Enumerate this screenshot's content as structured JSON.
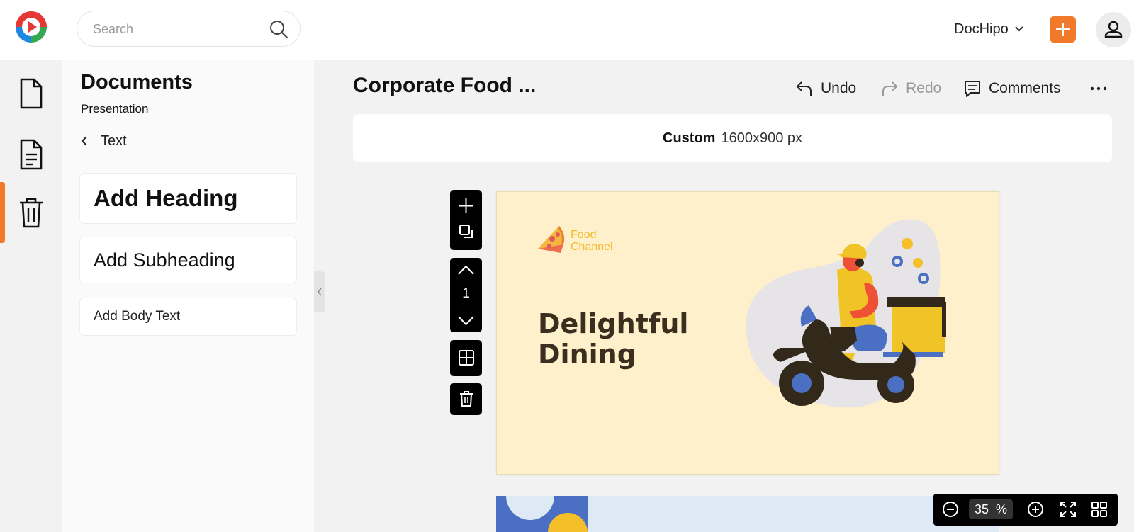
{
  "header": {
    "search_placeholder": "Search",
    "account_label": "DocHipo",
    "accent_color": "#f07a2a",
    "icons": [
      "app-logo-icon",
      "search-icon",
      "chevron-down-icon",
      "plus-icon",
      "user-icon"
    ]
  },
  "rail": {
    "items": [
      {
        "name": "document-icon",
        "active": false
      },
      {
        "name": "text-document-icon",
        "active": true
      },
      {
        "name": "trash-icon",
        "active": false
      }
    ]
  },
  "panel": {
    "title": "Documents",
    "subtitle": "Presentation",
    "back_label": "Text",
    "add_heading": "Add Heading",
    "add_subheading": "Add Subheading",
    "add_body_text": "Add Body Text"
  },
  "editor": {
    "doc_title": "Corporate Food ...",
    "undo_label": "Undo",
    "redo_label": "Redo",
    "comments_label": "Comments",
    "size_type": "Custom",
    "size_value": "1600x900 px",
    "page_number": "1"
  },
  "slide": {
    "brand_line1": "Food",
    "brand_line2": "Channel",
    "heading_line1": "Delightful",
    "heading_line2": "Dining",
    "background_color": "#fff0cc",
    "brand_color": "#f2bb2c",
    "heading_color": "#3a2f1e"
  },
  "zoom": {
    "value": "35",
    "unit": "%"
  }
}
